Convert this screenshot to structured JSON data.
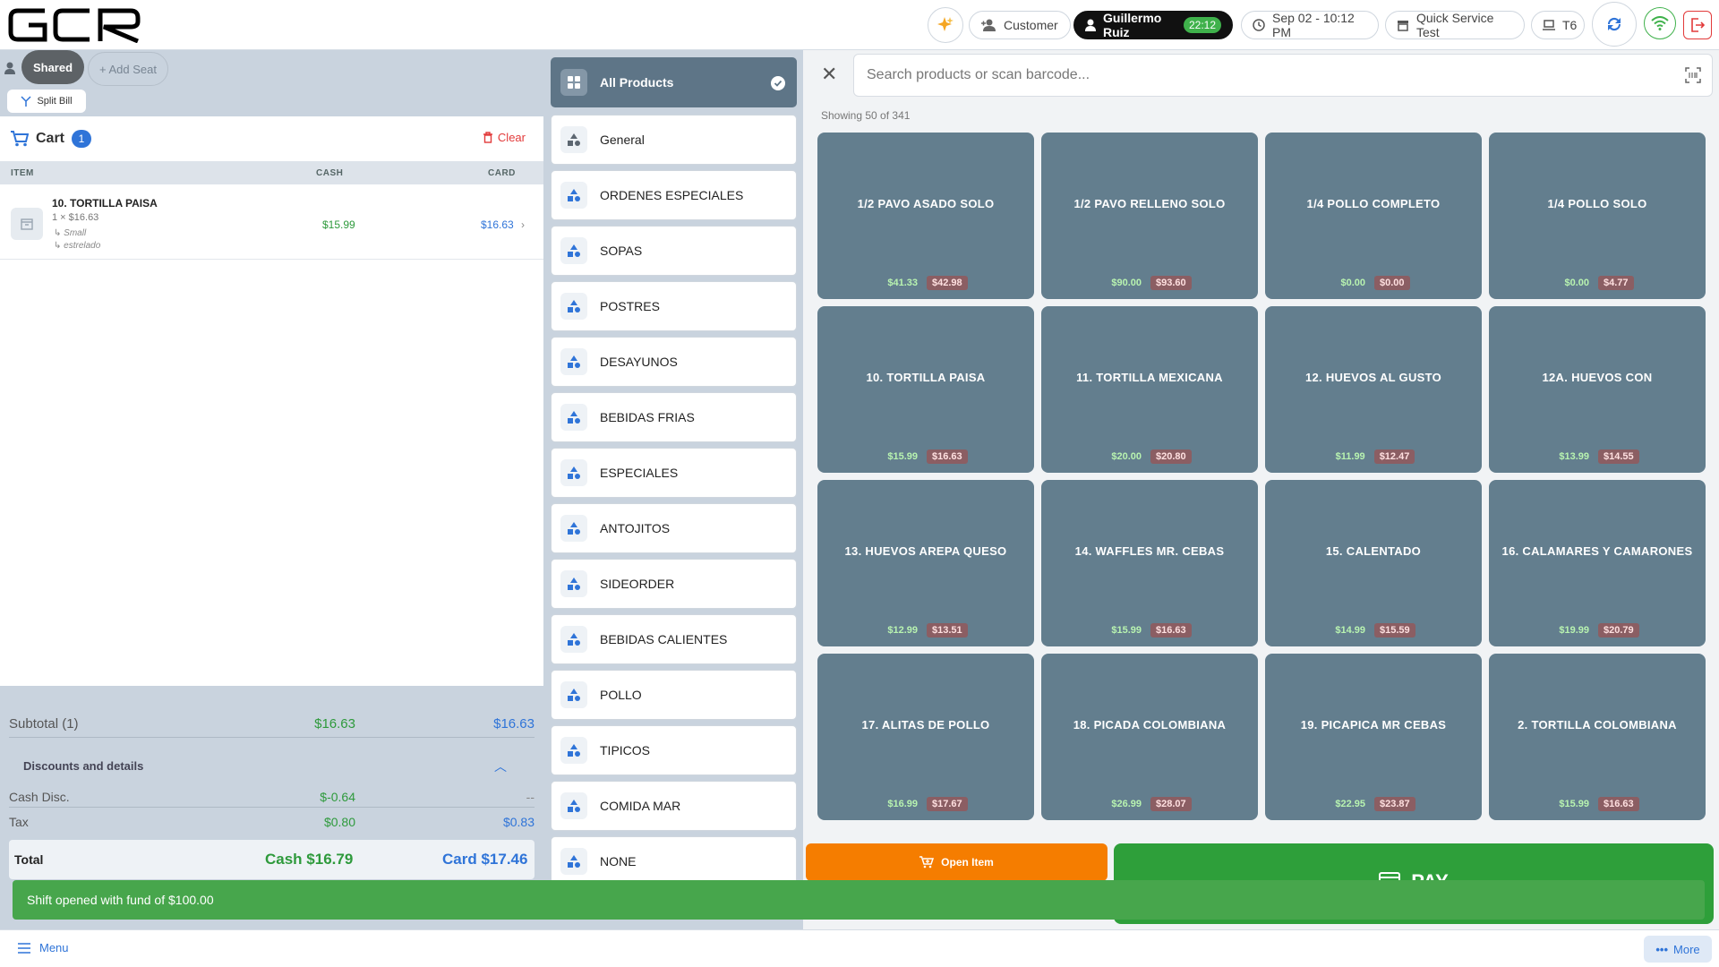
{
  "brand": {
    "logo_text": "GCR"
  },
  "header": {
    "customer_label": "Customer",
    "user_name": "Guillermo Ruiz",
    "user_timer": "22:12",
    "datetime": "Sep 02 - 10:12 PM",
    "store_name": "Quick Service Test",
    "terminal": "T6"
  },
  "seats": {
    "shared_label": "Shared",
    "add_seat_label": "+ Add Seat",
    "split_bill_label": "Split Bill"
  },
  "cart": {
    "title": "Cart",
    "count": "1",
    "clear_label": "Clear",
    "columns": {
      "item": "ITEM",
      "cash": "CASH",
      "card": "CARD"
    },
    "items": [
      {
        "name": "10. TORTILLA PAISA",
        "qty_line": "1 × $16.63",
        "modifiers": [
          "↳ Small",
          "↳ estrelado"
        ],
        "cash": "$15.99",
        "card": "$16.63"
      }
    ]
  },
  "totals": {
    "subtotal_label": "Subtotal (1)",
    "subtotal_cash": "$16.63",
    "subtotal_card": "$16.63",
    "discounts_label": "Discounts and details",
    "cash_disc_label": "Cash Disc.",
    "cash_disc_cash": "$-0.64",
    "cash_disc_card": "--",
    "tax_label": "Tax",
    "tax_cash": "$0.80",
    "tax_card": "$0.83",
    "total_label": "Total",
    "total_cash": "Cash $16.79",
    "total_card": "Card $17.46"
  },
  "categories": [
    "All Products",
    "General",
    "ORDENES ESPECIALES",
    "SOPAS",
    "POSTRES",
    "DESAYUNOS",
    "BEBIDAS FRIAS",
    "ESPECIALES",
    "ANTOJITOS",
    "SIDEORDER",
    "BEBIDAS CALIENTES",
    "POLLO",
    "TIPICOS",
    "COMIDA MAR",
    "NONE"
  ],
  "search": {
    "placeholder": "Search products or scan barcode...",
    "showing": "Showing 50 of 341"
  },
  "products": [
    {
      "name": "1/2 PAVO ASADO SOLO",
      "cash": "$41.33",
      "card": "$42.98"
    },
    {
      "name": "1/2 PAVO RELLENO SOLO",
      "cash": "$90.00",
      "card": "$93.60"
    },
    {
      "name": "1/4 POLLO COMPLETO",
      "cash": "$0.00",
      "card": "$0.00"
    },
    {
      "name": "1/4 POLLO SOLO",
      "cash": "$0.00",
      "card": "$4.77"
    },
    {
      "name": "10. TORTILLA PAISA",
      "cash": "$15.99",
      "card": "$16.63"
    },
    {
      "name": "11. TORTILLA MEXICANA",
      "cash": "$20.00",
      "card": "$20.80"
    },
    {
      "name": "12. HUEVOS AL GUSTO",
      "cash": "$11.99",
      "card": "$12.47"
    },
    {
      "name": "12A. HUEVOS CON",
      "cash": "$13.99",
      "card": "$14.55"
    },
    {
      "name": "13. HUEVOS AREPA QUESO",
      "cash": "$12.99",
      "card": "$13.51"
    },
    {
      "name": "14. WAFFLES  MR. CEBAS",
      "cash": "$15.99",
      "card": "$16.63"
    },
    {
      "name": "15. CALENTADO",
      "cash": "$14.99",
      "card": "$15.59"
    },
    {
      "name": "16. CALAMARES Y CAMARONES",
      "cash": "$19.99",
      "card": "$20.79"
    },
    {
      "name": "17. ALITAS  DE POLLO",
      "cash": "$16.99",
      "card": "$17.67"
    },
    {
      "name": "18. PICADA COLOMBIANA",
      "cash": "$26.99",
      "card": "$28.07"
    },
    {
      "name": "19. PICAPICA MR CEBAS",
      "cash": "$22.95",
      "card": "$23.87"
    },
    {
      "name": "2. TORTILLA COLOMBIANA",
      "cash": "$15.99",
      "card": "$16.63"
    }
  ],
  "actions": {
    "open_item_label": "Open Item",
    "pay_label": "PAY"
  },
  "toast": {
    "message": "Shift opened with fund of $100.00"
  },
  "footer": {
    "menu_label": "Menu",
    "more_label": "More"
  },
  "colors": {
    "accent_blue": "#2f74d8",
    "cash_green": "#2e9a3c",
    "tile_bg": "#637e8e",
    "open_item_orange": "#f57d00",
    "pay_green": "#2e9f3a",
    "toast_green": "#47a64c",
    "clear_red": "#e23a3a"
  }
}
